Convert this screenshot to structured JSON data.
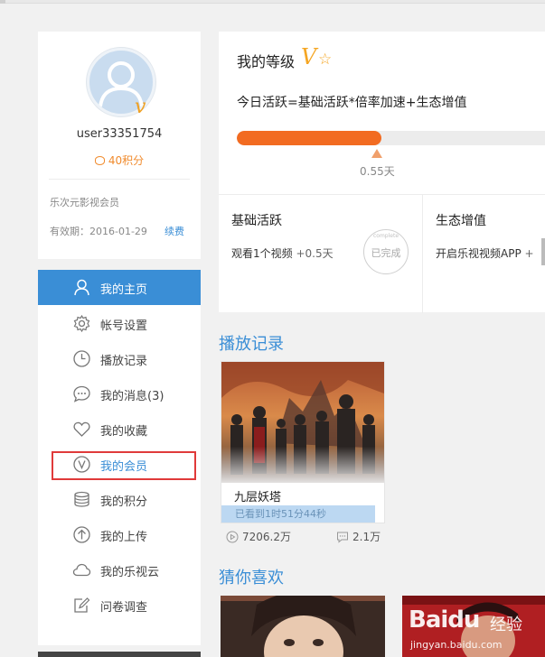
{
  "profile": {
    "username": "user33351754",
    "points": "40积分",
    "member_name": "乐次元影视会员",
    "expire": "有效期：2016-01-29",
    "renew": "续费"
  },
  "nav": {
    "items": [
      {
        "label": "我的主页",
        "icon": "user-icon",
        "active": true
      },
      {
        "label": "帐号设置",
        "icon": "gear-icon"
      },
      {
        "label": "播放记录",
        "icon": "clock-icon"
      },
      {
        "label": "我的消息(3)",
        "icon": "message-icon"
      },
      {
        "label": "我的收藏",
        "icon": "heart-icon"
      },
      {
        "label": "我的会员",
        "icon": "vip-v-icon",
        "highlighted": true
      },
      {
        "label": "我的积分",
        "icon": "coins-icon"
      },
      {
        "label": "我的上传",
        "icon": "upload-icon"
      },
      {
        "label": "我的乐视云",
        "icon": "cloud-icon"
      },
      {
        "label": "问卷调查",
        "icon": "survey-icon"
      }
    ]
  },
  "level": {
    "title": "我的等级",
    "formula": "今日活跃=基础活跃*倍率加速+生态增值",
    "progress_fraction": 0.47,
    "days": "0.55天"
  },
  "tasks": {
    "basic": {
      "title": "基础活跃",
      "desc": "观看1个视频",
      "plus": "+0.5天",
      "stamp": "已完成",
      "stamp_arc": "complete"
    },
    "eco": {
      "title": "生态增值",
      "desc": "开启乐视视频APP",
      "plus": "+"
    }
  },
  "history": {
    "section_title": "播放记录",
    "video": {
      "title": "九层妖塔",
      "watched": "已看到1时51分44秒",
      "plays": "7206.2万",
      "comments": "2.1万"
    }
  },
  "recommend": {
    "section_title": "猜你喜欢"
  },
  "watermark": {
    "brand": "Baidu",
    "cn": "经验",
    "url": "jingyan.baidu.com"
  },
  "colors": {
    "accent_blue": "#3a8ed6",
    "progress_orange": "#f26b21",
    "highlight_red": "#e03a3a",
    "points_orange": "#f08a2c"
  }
}
